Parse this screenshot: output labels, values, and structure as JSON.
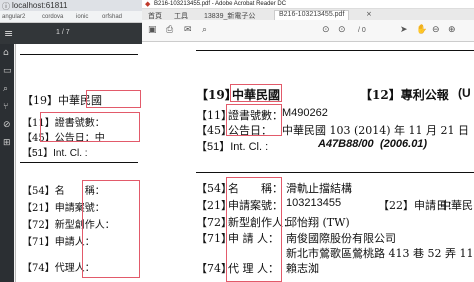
{
  "browser": {
    "url": "localhost:61811",
    "bookmarks": [
      "angular2",
      "cordova",
      "ionic",
      "orfshad"
    ],
    "page_indicator": "1 / 7",
    "document": {
      "field19": "【19】中華民國",
      "field11": "【11】證書號數：",
      "field45": "【45】公告日：中",
      "field51": "【51】Int. Cl. :",
      "field54": "【54】名　　稱：",
      "field21": "【21】申請案號：",
      "field72": "【72】新型創作人：",
      "field71": "【71】申請人：",
      "field74": "【74】代理人："
    }
  },
  "acrobat": {
    "title": "B216-103213455.pdf - Adobe Acrobat Reader DC",
    "menu": [
      "首頁",
      "工具",
      "13839_新電子公文...",
      "B216-103213455.pdf"
    ],
    "page_indicator": "/ 0",
    "document": {
      "h19": "【19】",
      "h19_val": "中華民國",
      "h12": "【12】專利公報",
      "h12_tail": "(U",
      "f11": "【11】",
      "f11_label": "證書號數：",
      "f11_val": "M490262",
      "f45": "【45】",
      "f45_label": "公告日：",
      "f45_val": "中華民國 103 (2014) 年 11 月 21 日",
      "f51": "【51】Int. Cl. :",
      "f51_val": "A47B88/00",
      "f51_year": "(2006.01)",
      "f54": "【54】",
      "f54_label": "名　　稱：",
      "f54_val": "滑軌止擋結構",
      "f21": "【21】",
      "f21_label": "申請案號：",
      "f21_val": "103213455",
      "f22": "【22】申請日：",
      "f22_val": "中華民",
      "f72": "【72】",
      "f72_label": "新型創作人：",
      "f72_val": "邱怡翔 (TW)",
      "f71": "【71】",
      "f71_label": "申 請 人：",
      "f71_val1": "南俊國際股份有限公司",
      "f71_val2": "新北市鶯歌區鶯桃路 413 巷 52 弄 11 號",
      "f74": "【74】",
      "f74_label": "代 理 人：",
      "f74_val": "賴志洳"
    }
  },
  "colors": {
    "highlight": "#e25a6a",
    "chrome_dark": "#323639",
    "acrobat_title": "#c0392b"
  }
}
